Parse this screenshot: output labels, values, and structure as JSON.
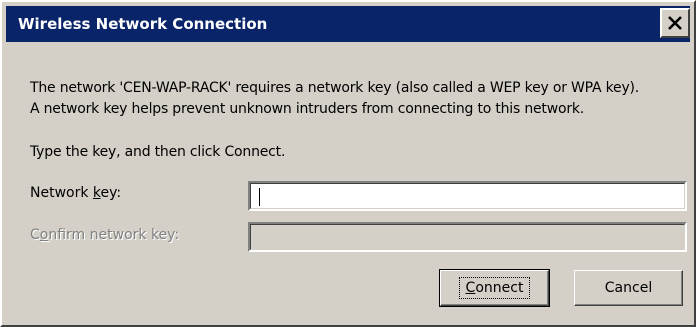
{
  "window": {
    "title": "Wireless Network Connection",
    "close_icon": "close-icon"
  },
  "message": {
    "line1": "The network 'CEN-WAP-RACK' requires a network key (also called a WEP key or WPA key).",
    "line2": "A network key helps prevent unknown intruders from connecting to this network.",
    "instruction": "Type the key, and then click Connect."
  },
  "form": {
    "network_key": {
      "label_pre": "Network ",
      "label_accel": "k",
      "label_post": "ey:",
      "value": "",
      "enabled": true
    },
    "confirm_key": {
      "label_pre": "C",
      "label_accel": "o",
      "label_post": "nfirm network key:",
      "value": "",
      "enabled": false
    }
  },
  "buttons": {
    "connect": {
      "label_accel": "C",
      "label_post": "onnect"
    },
    "cancel": {
      "label": "Cancel"
    }
  },
  "colors": {
    "titlebar": "#0a246a",
    "face": "#d4d0c8",
    "disabled_text": "#808080"
  }
}
